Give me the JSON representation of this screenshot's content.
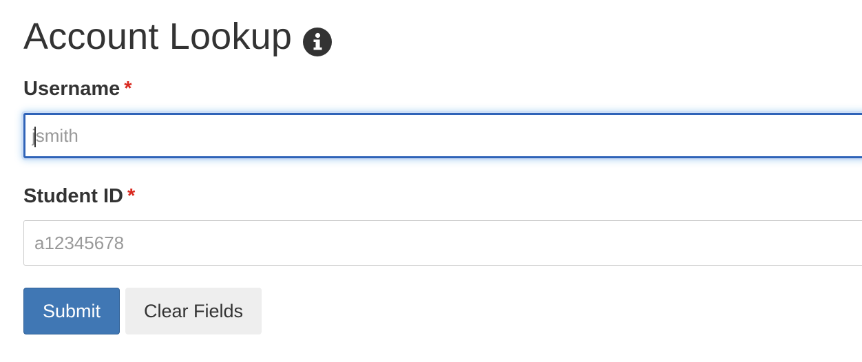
{
  "page": {
    "title": "Account Lookup",
    "title_icon": "info-circle-icon"
  },
  "form": {
    "username": {
      "label": "Username",
      "required_marker": "*",
      "placeholder": "jsmith",
      "value": "",
      "focused": true
    },
    "student_id": {
      "label": "Student ID",
      "required_marker": "*",
      "placeholder": "a12345678",
      "value": ""
    },
    "buttons": {
      "submit_label": "Submit",
      "clear_label": "Clear Fields"
    }
  },
  "colors": {
    "text": "#333333",
    "required": "#d9281e",
    "primary": "#4077b4",
    "focus_border": "#2f63b8",
    "secondary_button": "#eeeeee",
    "placeholder": "#999999"
  }
}
